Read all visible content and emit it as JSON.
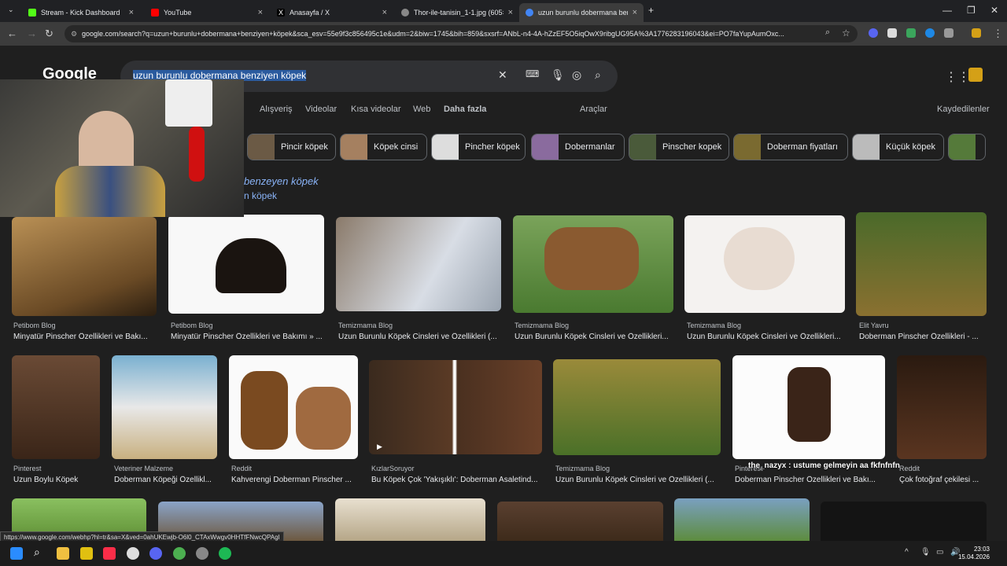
{
  "tabs": [
    {
      "title": "Stream - Kick Dashboard",
      "color": "#53fc18"
    },
    {
      "title": "YouTube",
      "color": "#ff0000"
    },
    {
      "title": "Anasayfa / X",
      "color": "#ffffff"
    },
    {
      "title": "Thor-ile-tanisin_1-1.jpg (605×6...",
      "color": "#888888"
    },
    {
      "title": "uzun burunlu dobermana benz...",
      "color": "#4285f4"
    }
  ],
  "address": "google.com/search?q=uzun+burunlu+dobermana+benziyen+köpek&sca_esv=55e9f3c856495c1e&udm=2&biw=1745&bih=859&sxsrf=ANbL-n4-4A-hZzEF5O5iqOwX9ribgUG95A%3A1776283196043&ei=PO7faYupAumOxc...",
  "logo": "Google",
  "query": "uzun burunlu dobermana benziyen köpek",
  "filters": [
    "Alışveriş",
    "Videolar",
    "Kısa videolar",
    "Web",
    "Daha fazla",
    "Araçlar",
    "Kaydedilenler"
  ],
  "chips": [
    "Pincir köpek",
    "Köpek cinsi",
    "Pincher köpek",
    "Dobermanlar",
    "Pinscher kopek",
    "Doberman fiyatları",
    "Küçük köpek"
  ],
  "heading": "benzeyen köpek",
  "heading_prefix": "n köpek",
  "results": [
    {
      "source": "Petibom Blog",
      "caption": "Minyatür Pinscher Özellikleri ve Bakı..."
    },
    {
      "source": "Petibom Blog",
      "caption": "Minyatür Pinscher Özellikleri ve Bakımı » ..."
    },
    {
      "source": "Temizmama Blog",
      "caption": "Uzun Burunlu Köpek Cinsleri ve Özellikleri (..."
    },
    {
      "source": "Temizmama Blog",
      "caption": "Uzun Burunlu Köpek Cinsleri ve Özellikleri..."
    },
    {
      "source": "Temizmama Blog",
      "caption": "Uzun Burunlu Köpek Cinsleri ve Özellikleri..."
    },
    {
      "source": "Elit Yavru",
      "caption": "Doberman Pinscher Özellikleri - ..."
    },
    {
      "source": "Pinterest",
      "caption": "Uzun Boylu Köpek"
    },
    {
      "source": "Veteriner Malzeme",
      "caption": "Doberman Köpeği Özellikl..."
    },
    {
      "source": "Reddit",
      "caption": "Kahverengi Doberman Pinscher ..."
    },
    {
      "source": "KızlarSoruyor",
      "caption": "Bu Köpek Çok 'Yakışıklı': Doberman Asaletind..."
    },
    {
      "source": "Temizmama Blog",
      "caption": "Uzun Burunlu Köpek Cinsleri ve Özellikleri (..."
    },
    {
      "source": "Pinterest",
      "caption": "Doberman Pinscher Özellikleri ve Bakı..."
    },
    {
      "source": "Reddit",
      "caption": "Çok fotoğraf çekilesi ..."
    }
  ],
  "chat_overlay": "the_nazyx : ustume gelmeyin aa fkfnfnfn",
  "status_url": "https://www.google.com/webhp?hl=tr&sa=X&ved=0ahUKEwjb-O6l0_CTAxWwgv0HHTfFNwcQPAgI",
  "clock": {
    "time": "23:03",
    "date": "15.04.2026"
  }
}
